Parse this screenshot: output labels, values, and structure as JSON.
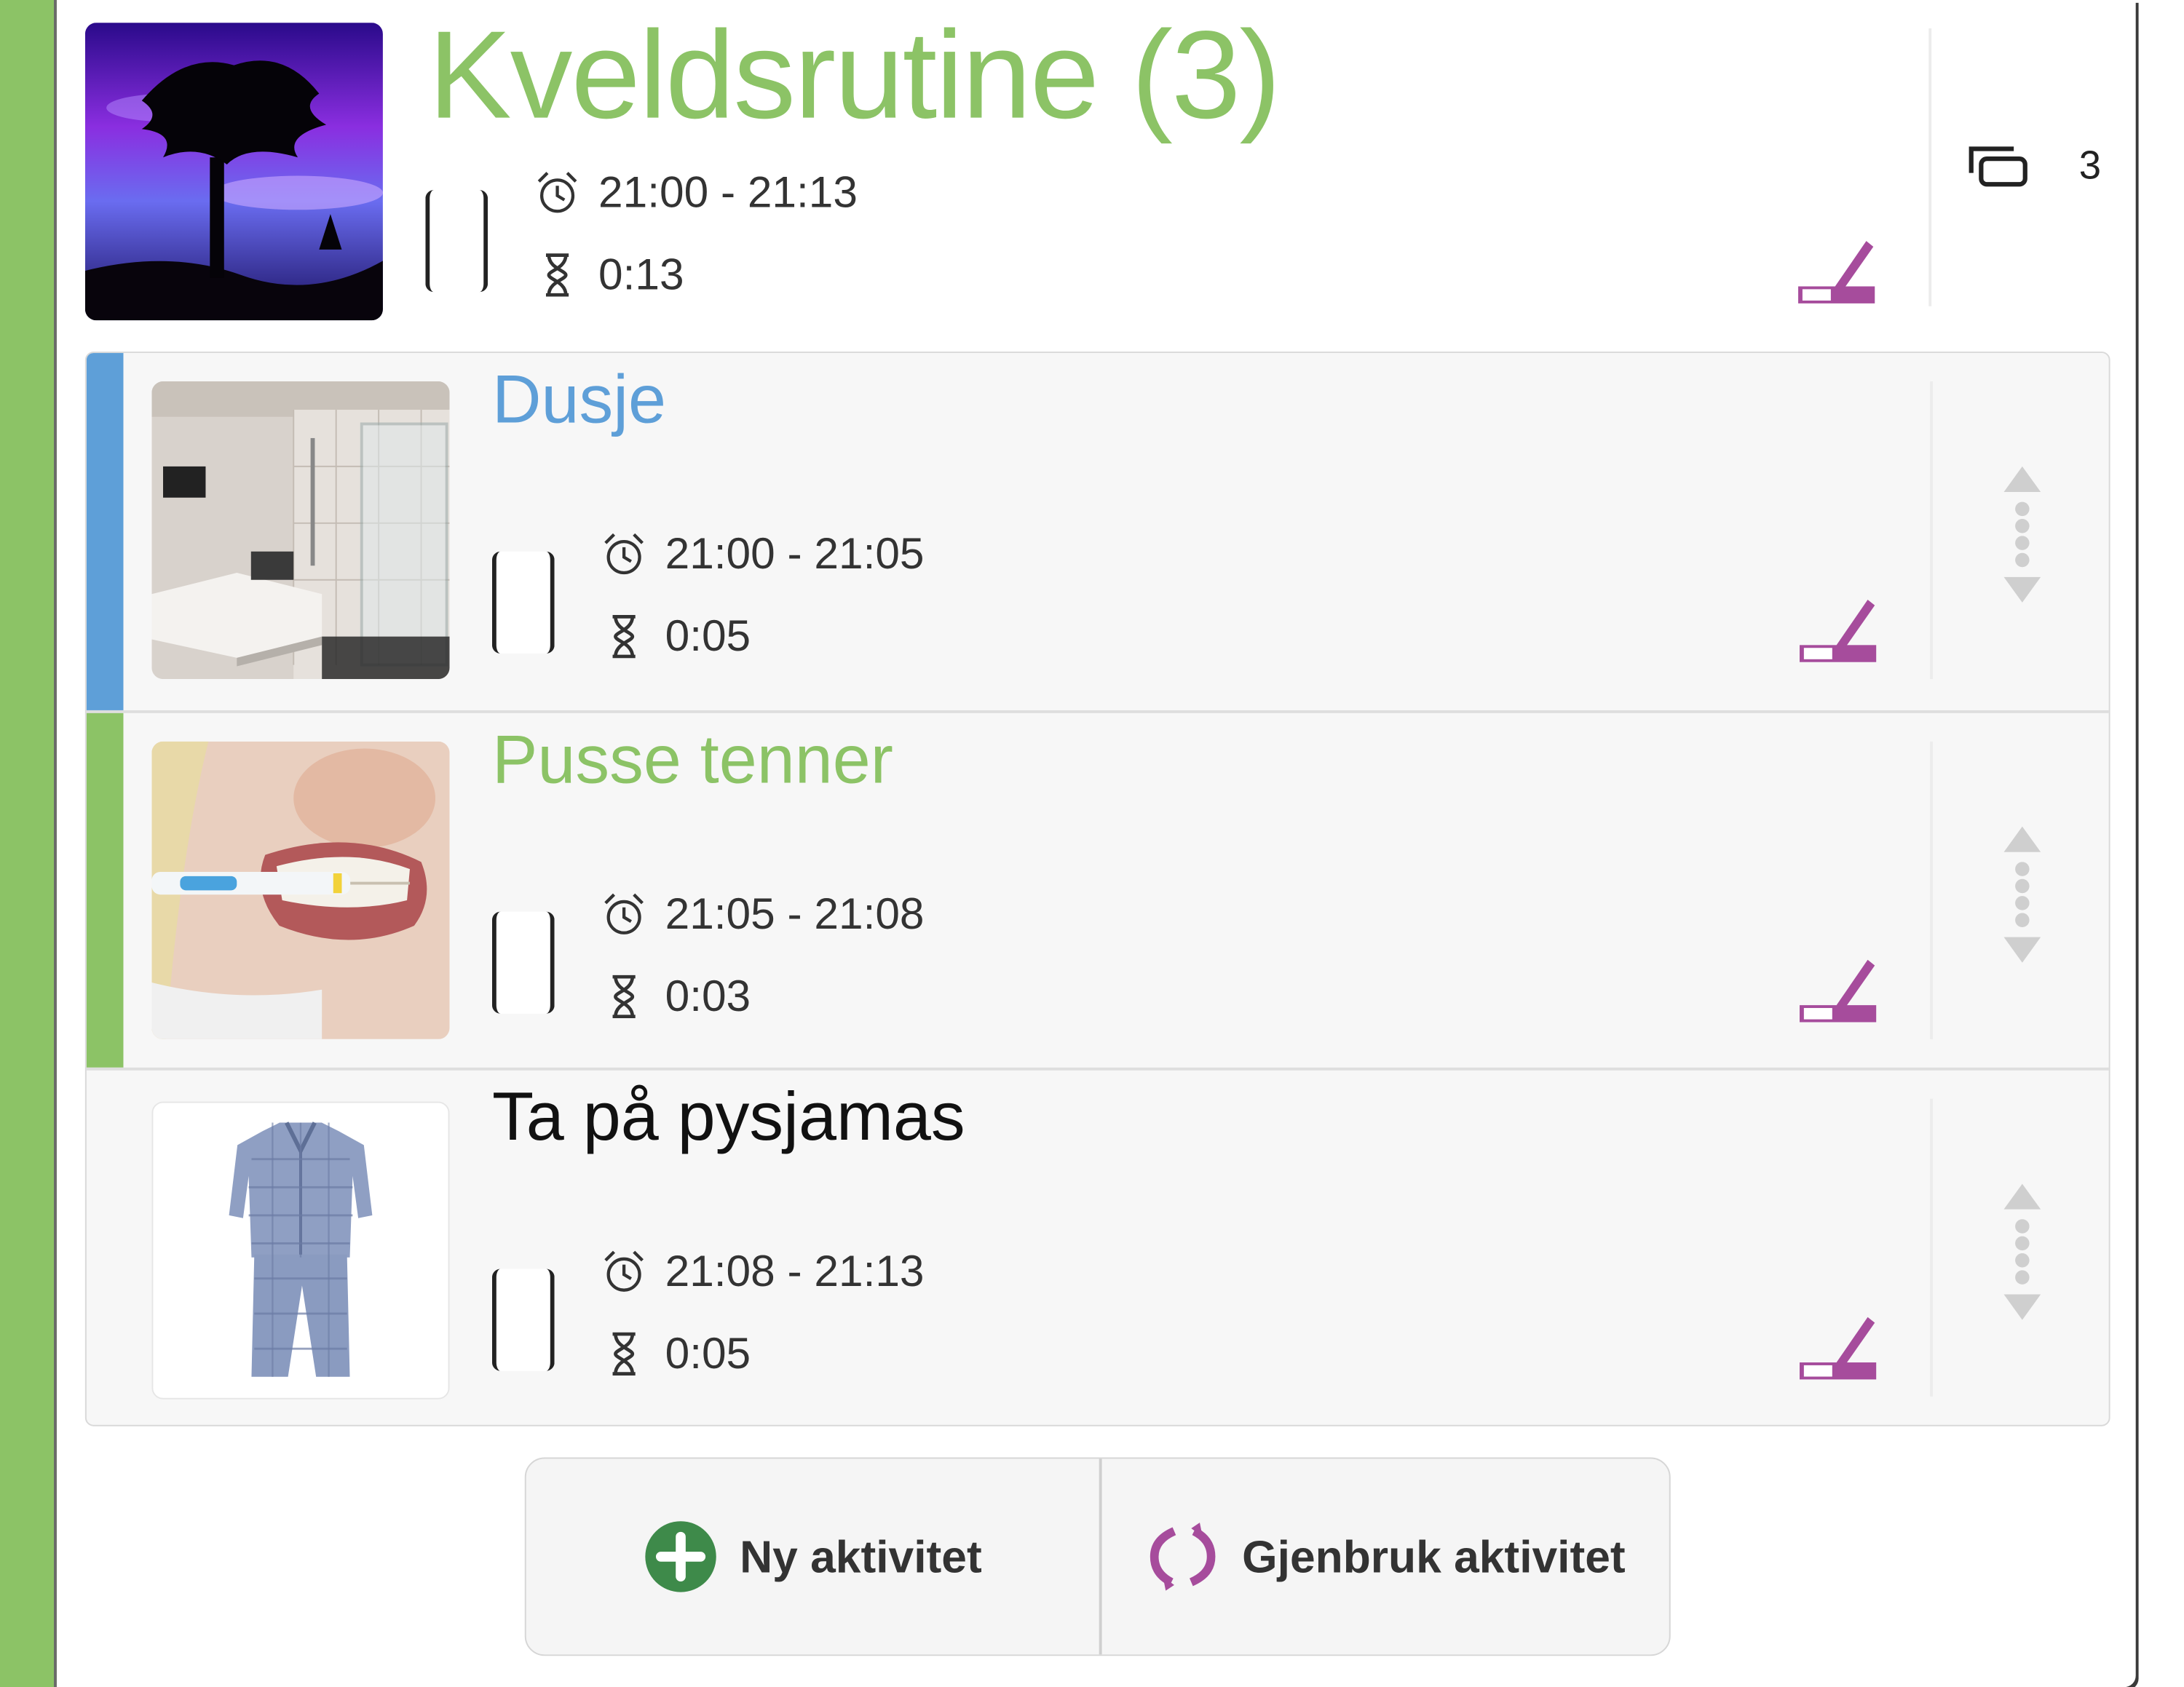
{
  "routine": {
    "title": "Kveldsrutine (3)",
    "time": "21:00 - 21:13",
    "duration": "0:13",
    "subcount": "3",
    "image_icon": "tree-sunset-image"
  },
  "activities": [
    {
      "title": "Dusje",
      "time": "21:00 - 21:05",
      "duration": "0:05",
      "color": "#5e9fd8",
      "image_icon": "shower-image"
    },
    {
      "title": "Pusse tenner",
      "time": "21:05 - 21:08",
      "duration": "0:03",
      "color": "#8cc366",
      "image_icon": "brushing-teeth-image"
    },
    {
      "title": "Ta på pysjamas",
      "time": "21:08 - 21:13",
      "duration": "0:05",
      "color": "#111111",
      "image_icon": "pajamas-image"
    }
  ],
  "actions": {
    "new_label": "Ny aktivitet",
    "reuse_label": "Gjenbruk aktivitet"
  },
  "colors": {
    "accent_green": "#8cc366",
    "edit_purple": "#a64c9c",
    "new_icon_green": "#3e8a4a"
  }
}
